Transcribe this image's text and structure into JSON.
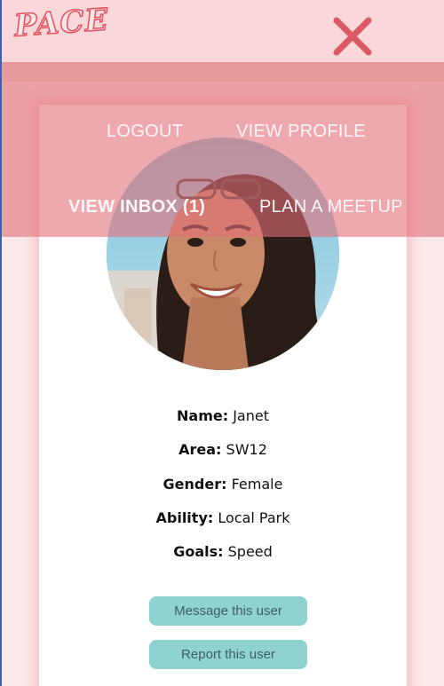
{
  "header": {
    "logo_text": "PACE",
    "close_icon": "close-x-icon",
    "accent_color": "#e0535f"
  },
  "nav": {
    "logout": "LOGOUT",
    "view_profile": "VIEW PROFILE",
    "view_inbox": "VIEW INBOX (1)",
    "plan_meetup": "PLAN A MEETUP"
  },
  "profile": {
    "fields": [
      {
        "label": "Name:",
        "value": "Janet"
      },
      {
        "label": "Area:",
        "value": "SW12"
      },
      {
        "label": "Gender:",
        "value": "Female"
      },
      {
        "label": "Ability:",
        "value": "Local Park"
      },
      {
        "label": "Goals:",
        "value": "Speed"
      }
    ]
  },
  "actions": {
    "message": "Message this user",
    "report": "Report this user"
  }
}
